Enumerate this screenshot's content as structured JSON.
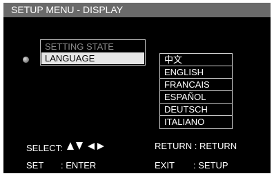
{
  "header": {
    "title": "SETUP MENU - DISPLAY"
  },
  "menu": {
    "items": [
      {
        "label": "SETTING STATE"
      },
      {
        "label": "LANGUAGE"
      }
    ]
  },
  "languages": {
    "options": [
      "中文",
      "ENGLISH",
      "FRANCAIS",
      "ESPAÑOL",
      "DEUTSCH",
      "ITALIANO"
    ]
  },
  "footer": {
    "select_label": "SELECT:",
    "return_label": "RETURN : RETURN",
    "set_label": "SET",
    "enter_label": ": ENTER",
    "exit_label": "EXIT",
    "setup_label": ": SETUP"
  },
  "colors": {
    "title_bar": "#6a6a6a",
    "background": "#000000",
    "highlight": "#e6e6e6",
    "text": "#ffffff",
    "dim_text": "#8a8a8a"
  },
  "icons": [
    "bullet-icon",
    "arrow-up-icon",
    "arrow-down-icon",
    "arrow-left-icon",
    "arrow-right-icon"
  ]
}
